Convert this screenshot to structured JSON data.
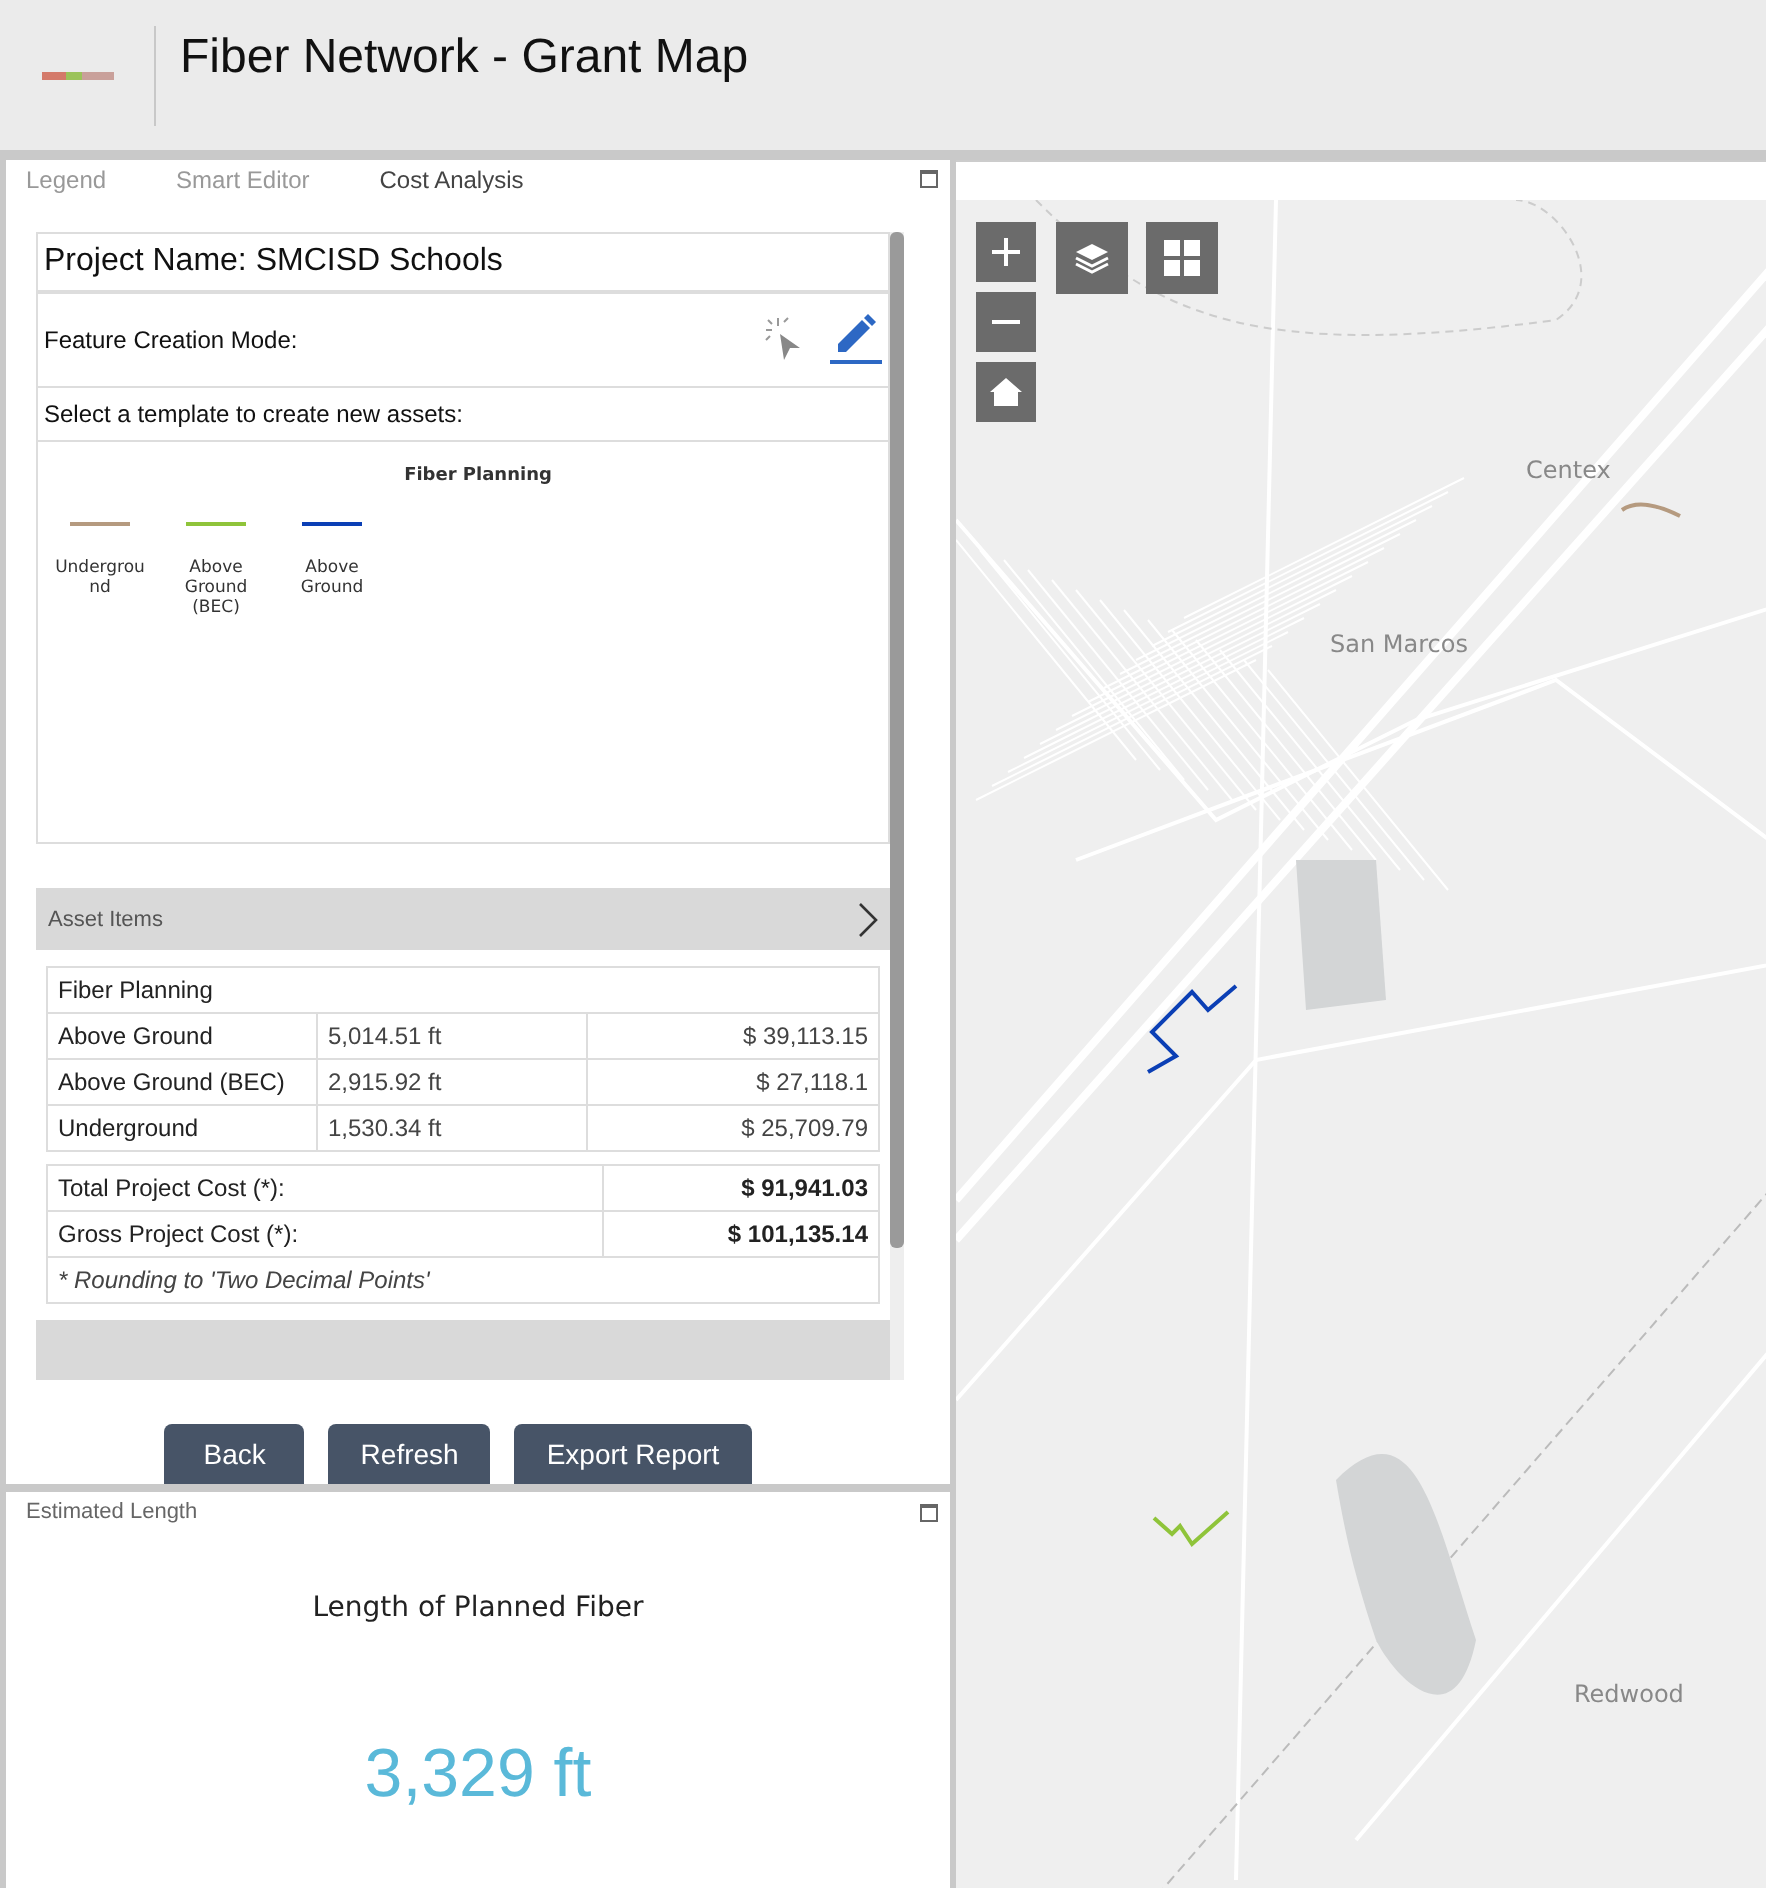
{
  "header": {
    "title": "Fiber Network - Grant Map"
  },
  "tabs": [
    {
      "label": "Legend",
      "selected": false
    },
    {
      "label": "Smart Editor",
      "selected": false
    },
    {
      "label": "Cost Analysis",
      "selected": true
    }
  ],
  "project": {
    "name": "Project Name: SMCISD Schools",
    "mode_label": "Feature Creation Mode:",
    "template_prompt": "Select a template to create new assets:",
    "template_group": "Fiber Planning",
    "templates": [
      {
        "label": "Undergrou nd",
        "color": "#b59a7f"
      },
      {
        "label": "Above Ground (BEC)",
        "color": "#8fc43a"
      },
      {
        "label": "Above Ground",
        "color": "#0b3fb5"
      }
    ]
  },
  "asset_items": {
    "title": "Asset Items",
    "expanded": true,
    "group": "Fiber Planning",
    "rows": [
      {
        "type": "Above Ground",
        "length": "5,014.51 ft",
        "cost": "$ 39,113.15"
      },
      {
        "type": "Above Ground (BEC)",
        "length": "2,915.92 ft",
        "cost": "$ 27,118.1"
      },
      {
        "type": "Underground",
        "length": "1,530.34 ft",
        "cost": "$ 25,709.79"
      }
    ],
    "totals": [
      {
        "label": "Total Project Cost (*):",
        "value": "$ 91,941.03"
      },
      {
        "label": "Gross Project Cost (*):",
        "value": "$ 101,135.14"
      }
    ],
    "note": "* Rounding to 'Two Decimal Points'"
  },
  "buttons": [
    "Back",
    "Refresh",
    "Export Report"
  ],
  "estimate": {
    "panel_title": "Estimated Length",
    "heading": "Length of Planned Fiber",
    "value": "3,329 ft"
  },
  "map": {
    "labels": [
      "Centex",
      "San Marcos",
      "Redwood"
    ]
  }
}
